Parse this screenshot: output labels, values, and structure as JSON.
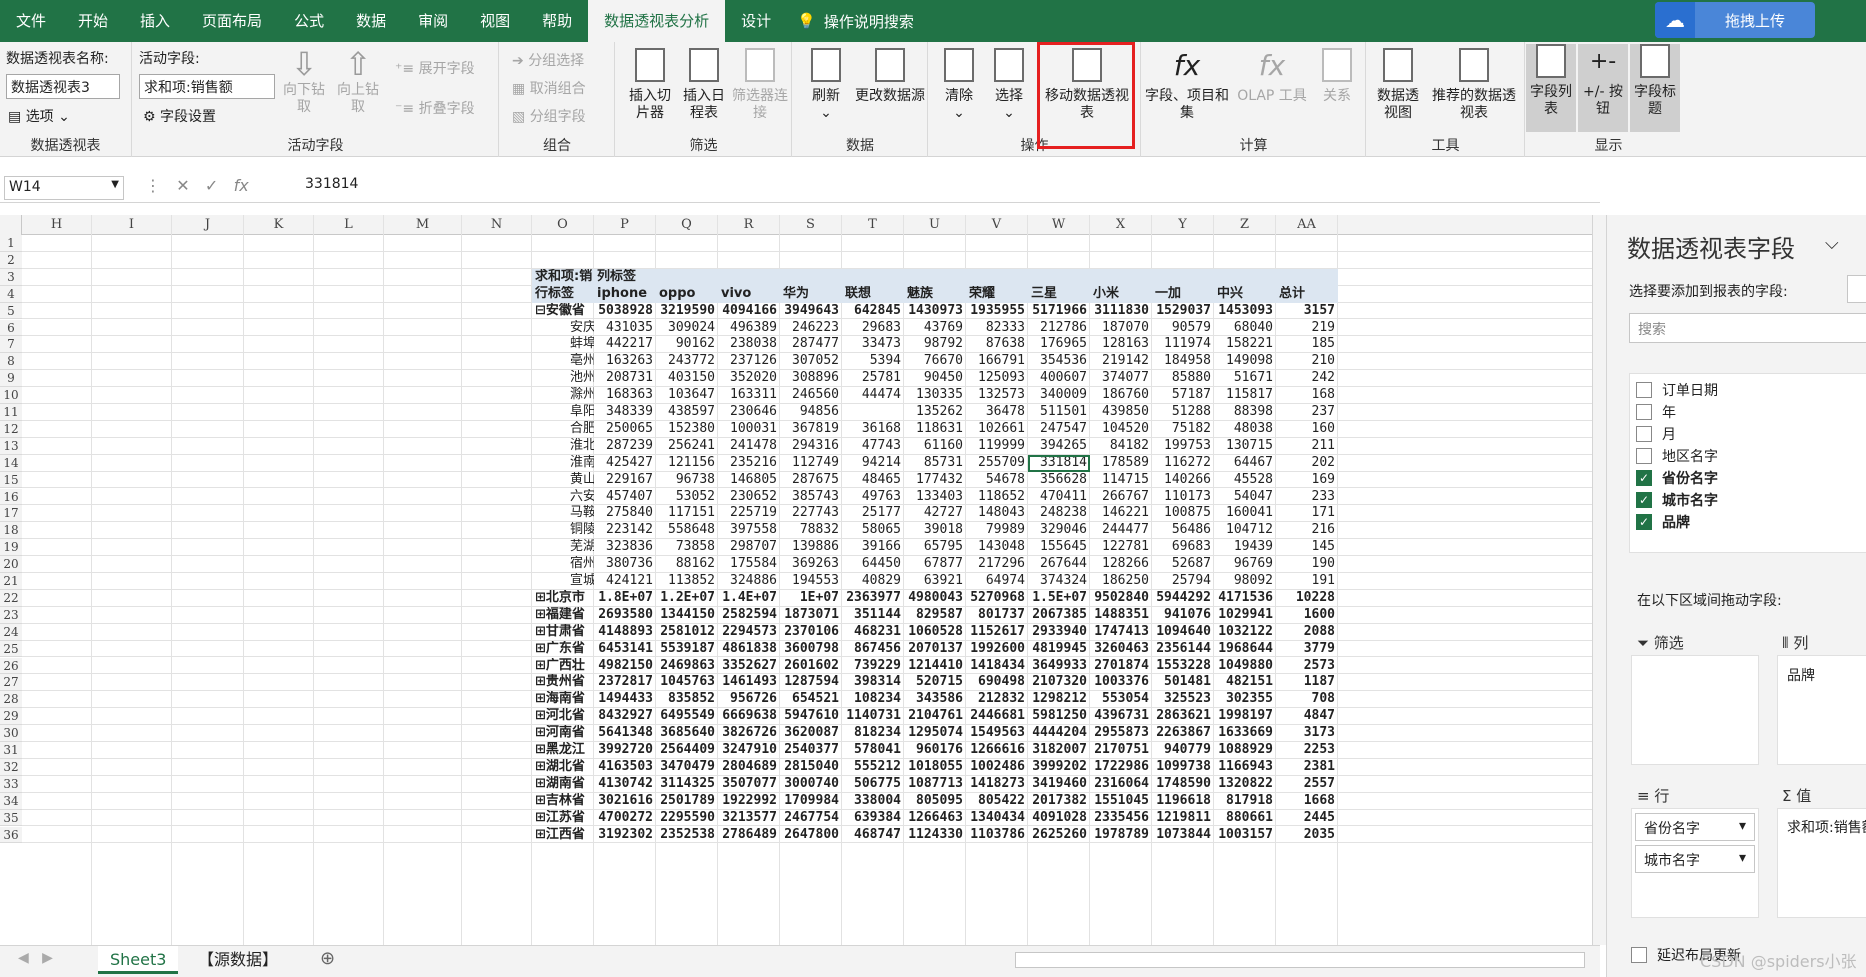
{
  "menubar": {
    "tabs": [
      "文件",
      "开始",
      "插入",
      "页面布局",
      "公式",
      "数据",
      "审阅",
      "视图",
      "帮助",
      "数据透视表分析",
      "设计"
    ],
    "active_tab": "数据透视表分析",
    "tell_me": "操作说明搜索",
    "upload_button": "拖拽上传"
  },
  "ribbon": {
    "pivot_name_label": "数据透视表名称:",
    "pivot_name_value": "数据透视表3",
    "options_label": "选项",
    "group_pivot": "数据透视表",
    "active_field_label": "活动字段:",
    "active_field_value": "求和项:销售额",
    "field_settings": "字段设置",
    "drill_down": "向下钻取",
    "drill_up": "向上钻取",
    "expand_field": "展开字段",
    "collapse_field": "折叠字段",
    "group_active_field": "活动字段",
    "group_selection": "分组选择",
    "ungroup": "取消组合",
    "group_field": "分组字段",
    "group_group": "组合",
    "insert_slicer": "插入切片器",
    "insert_timeline": "插入日程表",
    "filter_connections": "筛选器连接",
    "group_filter": "筛选",
    "refresh": "刷新",
    "change_source": "更改数据源",
    "group_data": "数据",
    "clear": "清除",
    "select": "选择",
    "move_pivot": "移动数据透视表",
    "group_actions": "操作",
    "fields_items_sets": "字段、项目和集",
    "olap_tools": "OLAP 工具",
    "relationships": "关系",
    "group_calc": "计算",
    "pivot_chart": "数据透视图",
    "recommended": "推荐的数据透视表",
    "group_tools": "工具",
    "field_list": "字段列表",
    "buttons": "+/- 按钮",
    "field_headers": "字段标题",
    "group_show": "显示"
  },
  "formula_bar": {
    "name_box": "W14",
    "formula": "331814"
  },
  "grid": {
    "columns": [
      "H",
      "I",
      "J",
      "K",
      "L",
      "M",
      "N",
      "O",
      "P",
      "Q",
      "R",
      "S",
      "T",
      "U",
      "V",
      "W",
      "X",
      "Y",
      "Z",
      "AA"
    ],
    "row_numbers": [
      "1",
      "2",
      "3",
      "4",
      "5",
      "6",
      "7",
      "8",
      "9",
      "10",
      "11",
      "12",
      "13",
      "14",
      "15",
      "16",
      "17",
      "18",
      "19",
      "20",
      "21",
      "22",
      "23",
      "24",
      "25",
      "26",
      "27",
      "28",
      "29",
      "30",
      "31",
      "32",
      "33",
      "34",
      "35",
      "36"
    ],
    "pivot_corner": "求和项:销",
    "col_labels_tag": "列标签",
    "row_labels_tag": "行标签",
    "brands": [
      "iphone",
      "oppo",
      "vivo",
      "华为",
      "联想",
      "魅族",
      "荣耀",
      "三星",
      "小米",
      "一加",
      "中兴",
      "总计"
    ],
    "rows": [
      {
        "label": "⊟安徽省",
        "bold": true,
        "values": [
          "5038928",
          "3219590",
          "4094166",
          "3949643",
          "642845",
          "1430973",
          "1935955",
          "5171966",
          "3111830",
          "1529037",
          "1453093",
          "3157"
        ]
      },
      {
        "label": "安庆",
        "values": [
          "431035",
          "309024",
          "496389",
          "246223",
          "29683",
          "43769",
          "82333",
          "212786",
          "187070",
          "90579",
          "68040",
          "219"
        ]
      },
      {
        "label": "蚌埠",
        "values": [
          "442217",
          "90162",
          "238038",
          "287477",
          "33473",
          "98792",
          "87638",
          "176965",
          "128163",
          "111974",
          "158221",
          "185"
        ]
      },
      {
        "label": "亳州",
        "values": [
          "163263",
          "243772",
          "237126",
          "307052",
          "5394",
          "76670",
          "166791",
          "354536",
          "219142",
          "184958",
          "149098",
          "210"
        ]
      },
      {
        "label": "池州",
        "values": [
          "208731",
          "403150",
          "352020",
          "308896",
          "25781",
          "90450",
          "125093",
          "400607",
          "374077",
          "85880",
          "51671",
          "242"
        ]
      },
      {
        "label": "滁州",
        "values": [
          "168363",
          "103647",
          "163311",
          "246560",
          "44474",
          "130335",
          "132573",
          "340009",
          "186760",
          "57187",
          "115817",
          "168"
        ]
      },
      {
        "label": "阜阳",
        "values": [
          "348339",
          "438597",
          "230646",
          "94856",
          "",
          "135262",
          "36478",
          "511501",
          "439850",
          "51288",
          "88398",
          "237"
        ]
      },
      {
        "label": "合肥",
        "values": [
          "250065",
          "152380",
          "100031",
          "367819",
          "36168",
          "118631",
          "102661",
          "247547",
          "104520",
          "75182",
          "48038",
          "160"
        ]
      },
      {
        "label": "淮北",
        "values": [
          "287239",
          "256241",
          "241478",
          "294316",
          "47743",
          "61160",
          "119999",
          "394265",
          "84182",
          "199753",
          "130715",
          "211"
        ]
      },
      {
        "label": "淮南",
        "values": [
          "425427",
          "121156",
          "235216",
          "112749",
          "94214",
          "85731",
          "255709",
          "331814",
          "178589",
          "116272",
          "64467",
          "202"
        ]
      },
      {
        "label": "黄山",
        "values": [
          "229167",
          "96738",
          "146805",
          "287675",
          "48465",
          "177432",
          "54678",
          "356628",
          "114715",
          "140266",
          "45528",
          "169"
        ]
      },
      {
        "label": "六安",
        "values": [
          "457407",
          "53052",
          "230652",
          "385743",
          "49763",
          "133403",
          "118652",
          "470411",
          "266767",
          "110173",
          "54047",
          "233"
        ]
      },
      {
        "label": "马鞍",
        "values": [
          "275840",
          "117151",
          "225719",
          "227743",
          "25177",
          "42727",
          "148043",
          "248238",
          "146221",
          "100875",
          "160041",
          "171"
        ]
      },
      {
        "label": "铜陵",
        "values": [
          "223142",
          "558648",
          "397558",
          "78832",
          "58065",
          "39018",
          "79989",
          "329046",
          "244477",
          "56486",
          "104712",
          "216"
        ]
      },
      {
        "label": "芜湖",
        "values": [
          "323836",
          "73858",
          "298707",
          "139886",
          "39166",
          "65795",
          "143048",
          "155645",
          "122781",
          "69683",
          "19439",
          "145"
        ]
      },
      {
        "label": "宿州",
        "values": [
          "380736",
          "88162",
          "175584",
          "369263",
          "64450",
          "67877",
          "217296",
          "267644",
          "128266",
          "52687",
          "96769",
          "190"
        ]
      },
      {
        "label": "宣城",
        "values": [
          "424121",
          "113852",
          "324886",
          "194553",
          "40829",
          "63921",
          "64974",
          "374324",
          "186250",
          "25794",
          "98092",
          "191"
        ]
      },
      {
        "label": "⊞北京市",
        "bold": true,
        "values": [
          "1.8E+07",
          "1.2E+07",
          "1.4E+07",
          "1E+07",
          "2363977",
          "4980043",
          "5270968",
          "1.5E+07",
          "9502840",
          "5944292",
          "4171536",
          "10228"
        ]
      },
      {
        "label": "⊞福建省",
        "bold": true,
        "values": [
          "2693580",
          "1344150",
          "2582594",
          "1873071",
          "351144",
          "829587",
          "801737",
          "2067385",
          "1488351",
          "941076",
          "1029941",
          "1600"
        ]
      },
      {
        "label": "⊞甘肃省",
        "bold": true,
        "values": [
          "4148893",
          "2581012",
          "2294573",
          "2370106",
          "468231",
          "1060528",
          "1152617",
          "2933940",
          "1747413",
          "1094640",
          "1032122",
          "2088"
        ]
      },
      {
        "label": "⊞广东省",
        "bold": true,
        "values": [
          "6453141",
          "5539187",
          "4861838",
          "3600798",
          "867456",
          "2070137",
          "1992600",
          "4819945",
          "3260463",
          "2356144",
          "1968644",
          "3779"
        ]
      },
      {
        "label": "⊞广西壮",
        "bold": true,
        "values": [
          "4982150",
          "2469863",
          "3352627",
          "2601602",
          "739229",
          "1214410",
          "1418434",
          "3649933",
          "2701874",
          "1553228",
          "1049880",
          "2573"
        ]
      },
      {
        "label": "⊞贵州省",
        "bold": true,
        "values": [
          "2372817",
          "1045763",
          "1461493",
          "1287594",
          "398314",
          "520715",
          "690498",
          "2107320",
          "1003376",
          "501481",
          "482151",
          "1187"
        ]
      },
      {
        "label": "⊞海南省",
        "bold": true,
        "values": [
          "1494433",
          "835852",
          "956726",
          "654521",
          "108234",
          "343586",
          "212832",
          "1298212",
          "553054",
          "325523",
          "302355",
          "708"
        ]
      },
      {
        "label": "⊞河北省",
        "bold": true,
        "values": [
          "8432927",
          "6495549",
          "6669638",
          "5947610",
          "1140731",
          "2104761",
          "2446681",
          "5981250",
          "4396731",
          "2863621",
          "1998197",
          "4847"
        ]
      },
      {
        "label": "⊞河南省",
        "bold": true,
        "values": [
          "5641348",
          "3685640",
          "3826726",
          "3620087",
          "818234",
          "1295074",
          "1549563",
          "4444204",
          "2955873",
          "2263867",
          "1633669",
          "3173"
        ]
      },
      {
        "label": "⊞黑龙江",
        "bold": true,
        "values": [
          "3992720",
          "2564409",
          "3247910",
          "2540377",
          "578041",
          "960176",
          "1266616",
          "3182007",
          "2170751",
          "940779",
          "1088929",
          "2253"
        ]
      },
      {
        "label": "⊞湖北省",
        "bold": true,
        "values": [
          "4163503",
          "3470479",
          "2804689",
          "2815040",
          "555212",
          "1018055",
          "1002486",
          "3999202",
          "1722986",
          "1099738",
          "1166943",
          "2381"
        ]
      },
      {
        "label": "⊞湖南省",
        "bold": true,
        "values": [
          "4130742",
          "3114325",
          "3507077",
          "3000740",
          "506775",
          "1087713",
          "1418273",
          "3419460",
          "2316064",
          "1748590",
          "1320822",
          "2557"
        ]
      },
      {
        "label": "⊞吉林省",
        "bold": true,
        "values": [
          "3021616",
          "2501789",
          "1922992",
          "1709984",
          "338004",
          "805095",
          "805422",
          "2017382",
          "1551045",
          "1196618",
          "817918",
          "1668"
        ]
      },
      {
        "label": "⊞江苏省",
        "bold": true,
        "values": [
          "4700272",
          "2295590",
          "3213577",
          "2467754",
          "639384",
          "1266463",
          "1340434",
          "4091028",
          "2335456",
          "1219811",
          "880661",
          "2445"
        ]
      },
      {
        "label": "⊞江西省",
        "bold": true,
        "values": [
          "3192302",
          "2352538",
          "2786489",
          "2647800",
          "468747",
          "1124330",
          "1103786",
          "2625260",
          "1978789",
          "1073844",
          "1003157",
          "2035"
        ]
      }
    ]
  },
  "sheets": {
    "active": "Sheet3",
    "other": "【源数据】"
  },
  "panel": {
    "title": "数据透视表字段",
    "subtitle": "选择要添加到报表的字段:",
    "search_placeholder": "搜索",
    "fields": [
      {
        "name": "订单日期",
        "checked": false
      },
      {
        "name": "年",
        "checked": false
      },
      {
        "name": "月",
        "checked": false
      },
      {
        "name": "地区名字",
        "checked": false
      },
      {
        "name": "省份名字",
        "checked": true
      },
      {
        "name": "城市名字",
        "checked": true
      },
      {
        "name": "品牌",
        "checked": true
      }
    ],
    "drag_hint": "在以下区域间拖动字段:",
    "filter_area": "筛选",
    "columns_area": "列",
    "rows_area": "行",
    "values_area": "值",
    "col_field": "品牌",
    "row_field_1": "省份名字",
    "row_field_2": "城市名字",
    "value_field": "求和项:销售额",
    "defer_update": "延迟布局更新"
  },
  "watermark": "CSDN @spiders小张"
}
